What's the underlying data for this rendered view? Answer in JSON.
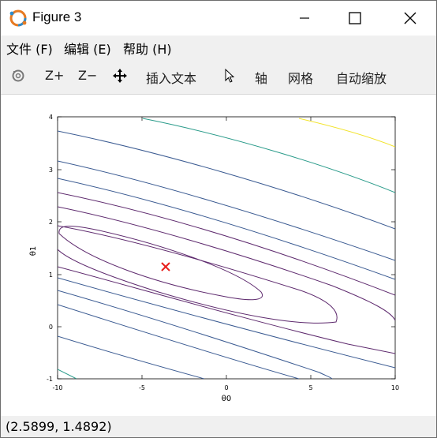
{
  "window": {
    "title": "Figure 3",
    "controls": {
      "minimize": "minimize",
      "maximize": "maximize",
      "close": "close"
    }
  },
  "menubar": {
    "items": [
      {
        "label": "文件 (F)"
      },
      {
        "label": "编辑 (E)"
      },
      {
        "label": "帮助 (H)"
      }
    ]
  },
  "toolbar": {
    "rotate_icon": "rotate-icon",
    "zoom_in": "Z+",
    "zoom_out": "Z−",
    "pan_icon": "pan-icon",
    "insert_text": "插入文本",
    "pointer_icon": "pointer-icon",
    "axes": "轴",
    "grid": "网格",
    "autoscale": "自动缩放"
  },
  "status": {
    "coords": "(2.5899, 1.4892)"
  },
  "chart_data": {
    "type": "contour",
    "xlabel": "θ0",
    "ylabel": "θ1",
    "xlim": [
      -10,
      10
    ],
    "ylim": [
      -1,
      4
    ],
    "xticks": [
      "-10",
      "-5",
      "0",
      "5",
      "10"
    ],
    "yticks": [
      "-1",
      "0",
      "1",
      "2",
      "3",
      "4"
    ],
    "minimum_marker": {
      "x": -3.63,
      "y": 1.17,
      "symbol": "x",
      "color": "#e8201c"
    },
    "colors": {
      "purple": "#5e2a6e",
      "blue": "#3b5b92",
      "teal": "#2a9b8a",
      "yellow": "#f2e32a"
    }
  }
}
